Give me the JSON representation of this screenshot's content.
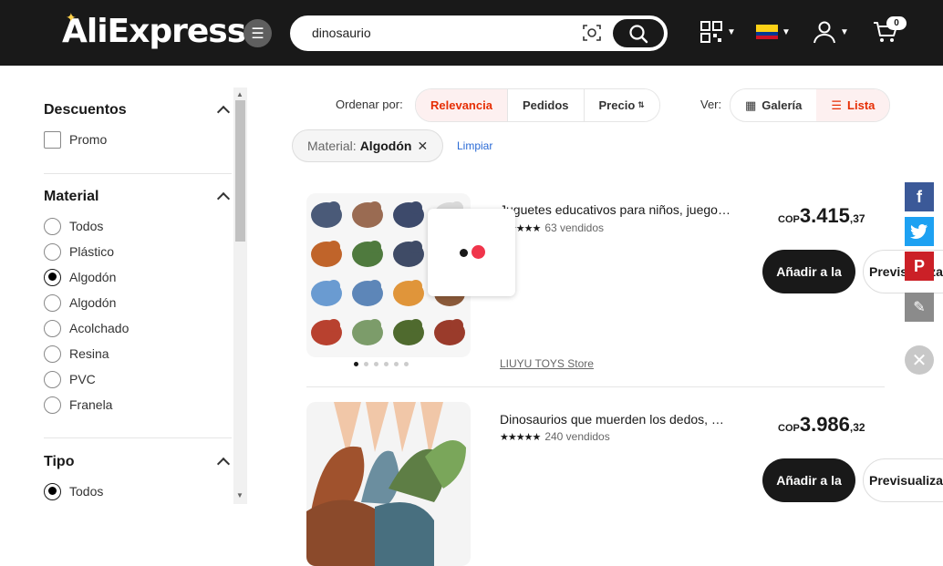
{
  "header": {
    "logo": "AliExpress",
    "search_value": "dinosaurio",
    "cart_count": "0",
    "colors": {
      "bg": "#191919",
      "accent": "#e62e04"
    }
  },
  "sidebar": {
    "descuentos": {
      "title": "Descuentos",
      "options": [
        "Promo"
      ]
    },
    "material": {
      "title": "Material",
      "options": [
        "Todos",
        "Plástico",
        "Algodón",
        "Algodón",
        "Acolchado",
        "Resina",
        "PVC",
        "Franela"
      ],
      "selected_index": 2
    },
    "tipo": {
      "title": "Tipo",
      "options": [
        "Todos"
      ],
      "selected_index": 0
    }
  },
  "sortbar": {
    "label": "Ordenar por:",
    "options": [
      "Relevancia",
      "Pedidos",
      "Precio"
    ],
    "active": "Relevancia",
    "view_label": "Ver:",
    "view_options": [
      "Galería",
      "Lista"
    ],
    "view_active": "Lista"
  },
  "filters": {
    "chip_key": "Material:",
    "chip_value": "Algodón",
    "clear": "Limpiar"
  },
  "products": [
    {
      "title": "Juguetes educativos para niños, juego…",
      "sold": "63 vendidos",
      "currency": "COP",
      "price_int": "3.415",
      "price_dec": ",37",
      "add_label": "Añadir a la",
      "preview_label": "Previsualizar",
      "store": "LIUYU TOYS Store"
    },
    {
      "title": "Dinosaurios que muerden los dedos, …",
      "sold": "240 vendidos",
      "currency": "COP",
      "price_int": "3.986",
      "price_dec": ",32",
      "add_label": "Añadir a la",
      "preview_label": "Previsualizar"
    }
  ],
  "share": {
    "icons": [
      "facebook-icon",
      "twitter-icon",
      "pinterest-icon",
      "edit-icon",
      "close-icon"
    ],
    "colors": [
      "#3b5998",
      "#1da1f2",
      "#cb2027",
      "#8b8b8b",
      "#c8c8c8"
    ]
  }
}
